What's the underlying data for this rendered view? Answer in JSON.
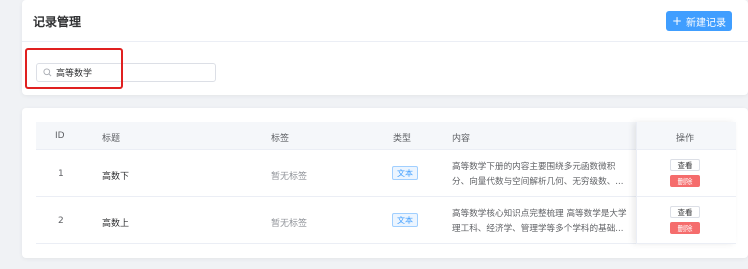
{
  "header": {
    "title": "记录管理",
    "new_button_label": "新建记录"
  },
  "search": {
    "value": "高等数学"
  },
  "table": {
    "columns": [
      "ID",
      "标题",
      "标签",
      "类型",
      "内容",
      "操作"
    ],
    "rows": [
      {
        "id": "1",
        "title": "高数下",
        "tag": "暂无标签",
        "type": "文本",
        "content": "高等数学下册的内容主要围绕多元函数微积分、向量代数与空间解析几何、无穷级数、...",
        "view_label": "查看",
        "delete_label": "删除"
      },
      {
        "id": "2",
        "title": "高数上",
        "tag": "暂无标签",
        "type": "文本",
        "content": "高等数学核心知识点完整梳理 高等数学是大学理工科、经济学、管理学等多个学科的基础...",
        "view_label": "查看",
        "delete_label": "删除"
      }
    ]
  },
  "colors": {
    "primary": "#409eff",
    "danger": "#f56c6c",
    "highlight": "#e02020"
  }
}
